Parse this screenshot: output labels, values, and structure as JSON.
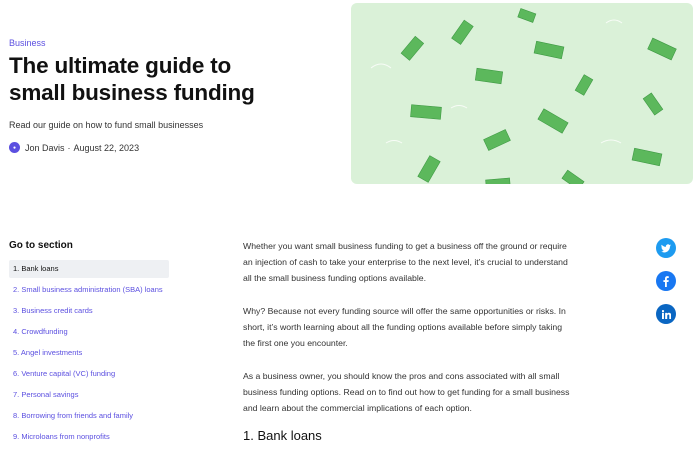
{
  "hero": {
    "category": "Business",
    "title_line1": "The ultimate guide to",
    "title_line2": "small business funding",
    "subtitle": "Read our guide on how to fund small businesses",
    "author": "Jon Davis",
    "separator": "·",
    "date": "August 22, 2023"
  },
  "toc": {
    "title": "Go to section",
    "items": [
      {
        "label": "1. Bank loans",
        "active": true
      },
      {
        "label": "2. Small business administration (SBA) loans"
      },
      {
        "label": "3. Business credit cards"
      },
      {
        "label": "4. Crowdfunding"
      },
      {
        "label": "5. Angel investments"
      },
      {
        "label": "6. Venture capital (VC) funding"
      },
      {
        "label": "7. Personal savings"
      },
      {
        "label": "8. Borrowing from friends and family"
      },
      {
        "label": "9. Microloans from nonprofits"
      }
    ]
  },
  "article": {
    "p1": "Whether you want small business funding to get a business off the ground or require an injection of cash to take your enterprise to the next level, it’s crucial to understand all the small business funding options available.",
    "p2": "Why? Because not every funding source will offer the same opportunities or risks. In short, it’s worth learning about all the funding options available before simply taking the first one you encounter.",
    "p3": "As a business owner, you should know the pros and cons associated with all small business funding options. Read on to find out how to get funding for a small business and learn about the commercial implications of each option.",
    "h2": "1. Bank loans"
  },
  "share": {
    "icons": [
      "twitter-icon",
      "facebook-icon",
      "linkedin-icon"
    ]
  },
  "colors": {
    "accent": "#5b4fe0",
    "hero_bg": "#daf1d8",
    "bill": "#5cb85c",
    "twitter": "#1d9bf0",
    "facebook": "#1877f2",
    "linkedin": "#0a66c2"
  }
}
